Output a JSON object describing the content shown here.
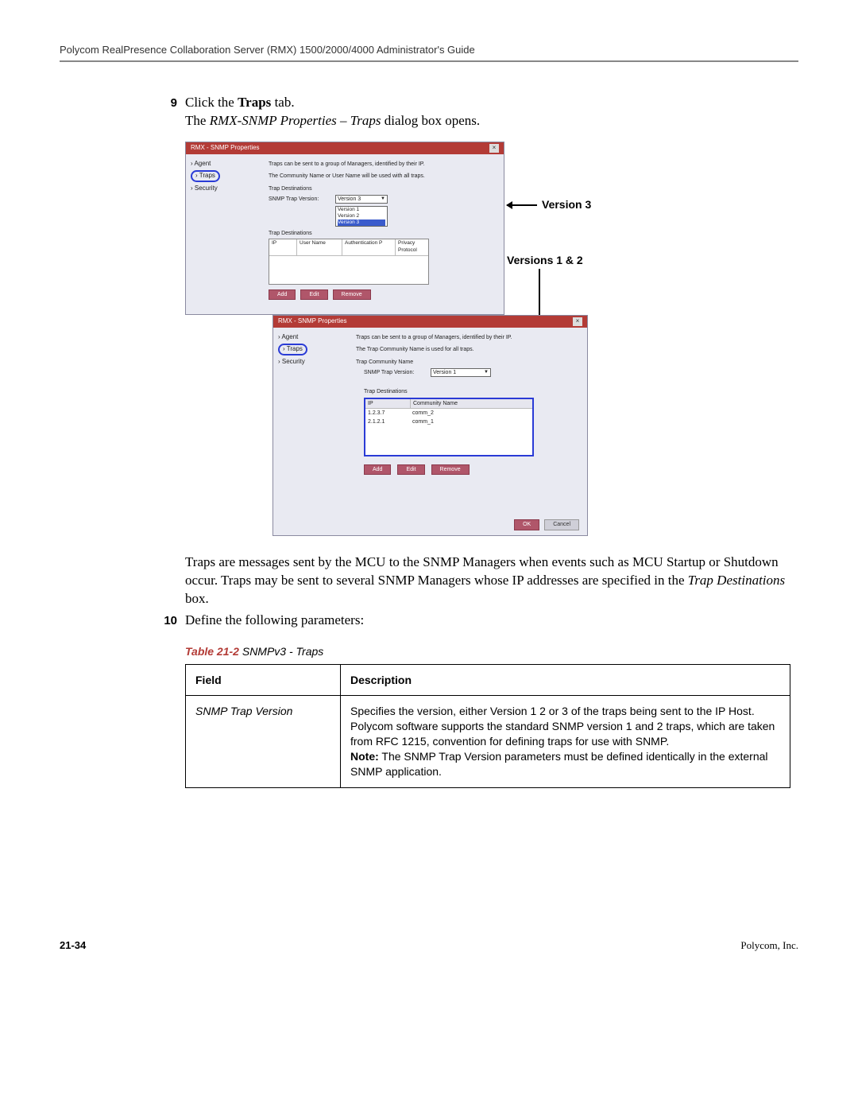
{
  "header": "Polycom RealPresence Collaboration Server (RMX) 1500/2000/4000 Administrator's Guide",
  "step9": {
    "num": "9",
    "line1_a": "Click the ",
    "line1_b": "Traps",
    "line1_c": " tab.",
    "line2_a": "The ",
    "line2_b": "RMX-SNMP Properties – Traps",
    "line2_c": " dialog box opens."
  },
  "dlg1": {
    "title": "RMX - SNMP Properties",
    "nav": {
      "agent": "Agent",
      "traps": "Traps",
      "security": "Security"
    },
    "intro1": "Traps can be sent to a group of Managers, identified by their IP.",
    "intro2": "The Community Name or User Name will be used with all traps.",
    "grp1": "Trap Destinations",
    "lbl_ver": "SNMP Trap Version:",
    "dd_sel": "Version 3",
    "dd_opts": [
      "Version 1",
      "Version 2",
      "Version 3"
    ],
    "grp2": "Trap Destinations",
    "th": {
      "ip": "IP",
      "user": "User Name",
      "auth": "Authentication P",
      "priv": "Privacy Protocol"
    },
    "btns": {
      "add": "Add",
      "edit": "Edit",
      "remove": "Remove"
    }
  },
  "dlg2": {
    "title": "RMX - SNMP Properties",
    "nav": {
      "agent": "Agent",
      "traps": "Traps",
      "security": "Security"
    },
    "intro1": "Traps can be sent to a group of Managers, identified by their IP.",
    "intro2": "The Trap Community Name is used for all traps.",
    "grp1": "Trap Community Name",
    "lbl_ver": "SNMP Trap Version:",
    "dd_sel": "Version 1",
    "grp2": "Trap Destinations",
    "th": {
      "ip": "IP",
      "comm": "Community Name"
    },
    "rows": [
      {
        "ip": "1.2.3.7",
        "comm": "comm_2"
      },
      {
        "ip": "2.1.2.1",
        "comm": "comm_1"
      }
    ],
    "btns": {
      "add": "Add",
      "edit": "Edit",
      "remove": "Remove",
      "ok": "OK",
      "cancel": "Cancel"
    }
  },
  "callouts": {
    "v3": "Version 3",
    "v12": "Versions 1 & 2"
  },
  "para": {
    "a": "Traps are messages sent by the MCU to the SNMP Managers when events such as MCU Startup or Shutdown occur. Traps may be sent to several SNMP Managers whose IP addresses are specified in the ",
    "b": "Trap Destinations",
    "c": " box."
  },
  "step10": {
    "num": "10",
    "text": "Define the following parameters:"
  },
  "table": {
    "caption_red": "Table 21-2",
    "caption_rest": "  SNMPv3 - Traps",
    "h1": "Field",
    "h2": "Description",
    "r1f": "SNMP Trap Version",
    "r1d_a": "Specifies the version, either Version 1 2 or 3 of the traps being sent to the IP Host. Polycom software supports the standard SNMP version 1 and 2 traps, which are taken from RFC 1215, convention for defining traps for use with SNMP.",
    "r1d_note_label": "Note:",
    "r1d_note_text": " The SNMP Trap Version parameters must be defined identically in the external SNMP application."
  },
  "footer": {
    "page": "21-34",
    "company": "Polycom, Inc."
  }
}
